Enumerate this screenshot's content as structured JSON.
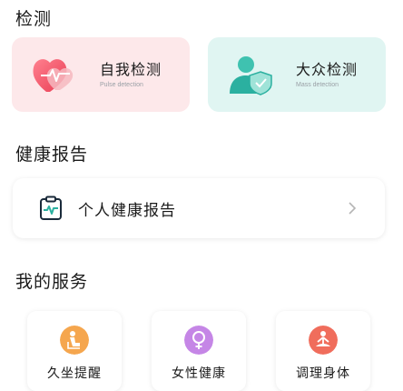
{
  "detection": {
    "title": "检测",
    "pulse": {
      "title": "自我检测",
      "subtitle": "Pulse detection",
      "icon": "heart-pulse-icon"
    },
    "mass": {
      "title": "大众检测",
      "subtitle": "Mass detection",
      "icon": "person-shield-icon"
    }
  },
  "health_report": {
    "title": "健康报告",
    "item": {
      "label": "个人健康报告",
      "icon": "clipboard-pulse-icon"
    }
  },
  "services": {
    "title": "我的服务",
    "items": [
      {
        "label": "久坐提醒",
        "icon": "sitting-icon",
        "color": "#f5a64e"
      },
      {
        "label": "女性健康",
        "icon": "female-icon",
        "color": "#c586e6"
      },
      {
        "label": "调理身体",
        "icon": "meditation-icon",
        "color": "#f06d5c"
      }
    ]
  },
  "colors": {
    "pulse_bg": "#fde8ea",
    "mass_bg": "#e0f5f2",
    "accent_red": "#ef4a5f",
    "accent_teal": "#2bb0a0"
  }
}
